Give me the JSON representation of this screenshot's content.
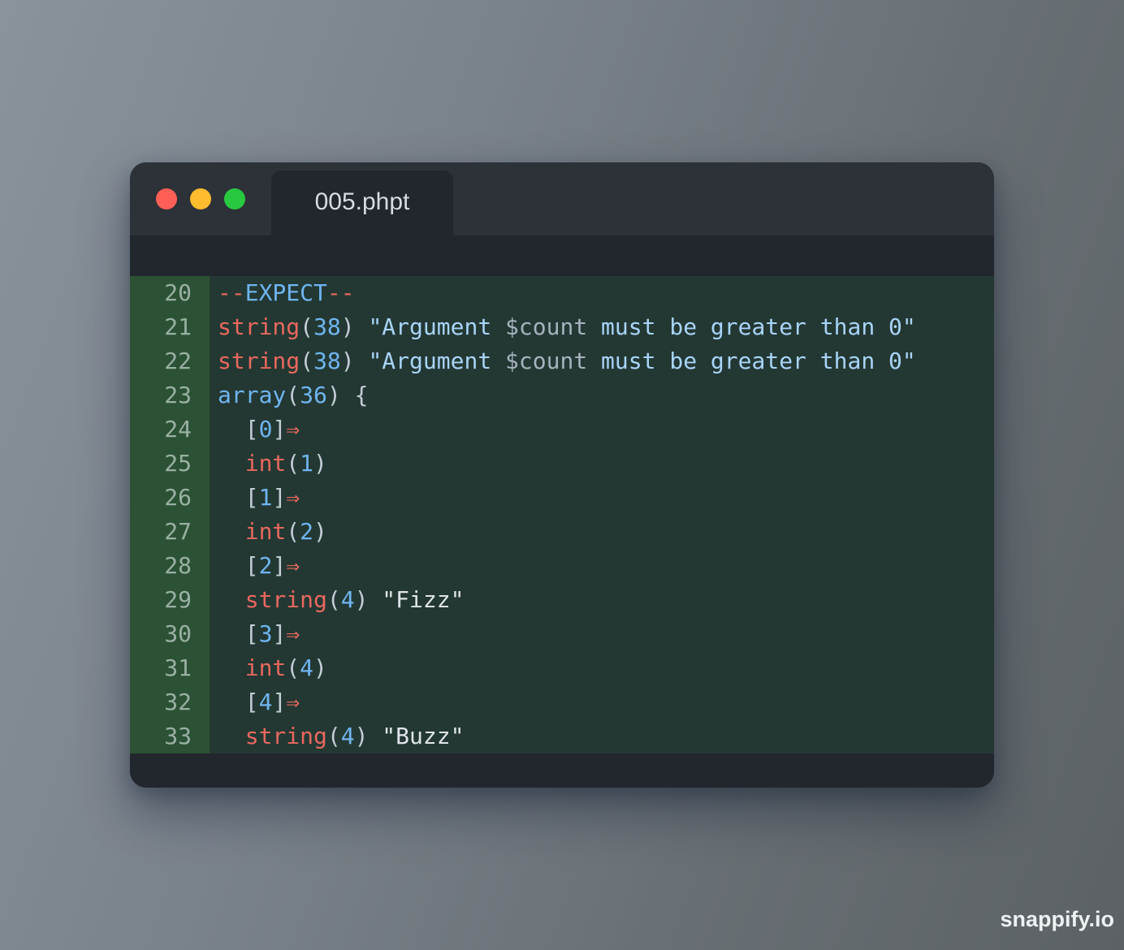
{
  "window": {
    "tab_label": "005.phpt"
  },
  "editor": {
    "lines": [
      {
        "number": "20",
        "tokens": [
          [
            "k",
            "--"
          ],
          [
            "b",
            "EXPECT"
          ],
          [
            "k",
            "--"
          ]
        ]
      },
      {
        "number": "21",
        "tokens": [
          [
            "k",
            "string"
          ],
          [
            "p",
            "("
          ],
          [
            "b",
            "38"
          ],
          [
            "p",
            ") "
          ],
          [
            "s",
            "\"Argument "
          ],
          [
            "v",
            "$count"
          ],
          [
            "s",
            " must be greater than 0\""
          ]
        ]
      },
      {
        "number": "22",
        "tokens": [
          [
            "k",
            "string"
          ],
          [
            "p",
            "("
          ],
          [
            "b",
            "38"
          ],
          [
            "p",
            ") "
          ],
          [
            "s",
            "\"Argument "
          ],
          [
            "v",
            "$count"
          ],
          [
            "s",
            " must be greater than 0\""
          ]
        ]
      },
      {
        "number": "23",
        "tokens": [
          [
            "b",
            "array"
          ],
          [
            "p",
            "("
          ],
          [
            "b",
            "36"
          ],
          [
            "p",
            ") {"
          ]
        ]
      },
      {
        "number": "24",
        "tokens": [
          [
            "p",
            "  ["
          ],
          [
            "b",
            "0"
          ],
          [
            "p",
            "]"
          ],
          [
            "k",
            "⇒"
          ]
        ]
      },
      {
        "number": "25",
        "tokens": [
          [
            "k",
            "  int"
          ],
          [
            "p",
            "("
          ],
          [
            "b",
            "1"
          ],
          [
            "p",
            ")"
          ]
        ]
      },
      {
        "number": "26",
        "tokens": [
          [
            "p",
            "  ["
          ],
          [
            "b",
            "1"
          ],
          [
            "p",
            "]"
          ],
          [
            "k",
            "⇒"
          ]
        ]
      },
      {
        "number": "27",
        "tokens": [
          [
            "k",
            "  int"
          ],
          [
            "p",
            "("
          ],
          [
            "b",
            "2"
          ],
          [
            "p",
            ")"
          ]
        ]
      },
      {
        "number": "28",
        "tokens": [
          [
            "p",
            "  ["
          ],
          [
            "b",
            "2"
          ],
          [
            "p",
            "]"
          ],
          [
            "k",
            "⇒"
          ]
        ]
      },
      {
        "number": "29",
        "tokens": [
          [
            "k",
            "  string"
          ],
          [
            "p",
            "("
          ],
          [
            "b",
            "4"
          ],
          [
            "p",
            ") "
          ],
          [
            "w",
            "\"Fizz\""
          ]
        ]
      },
      {
        "number": "30",
        "tokens": [
          [
            "p",
            "  ["
          ],
          [
            "b",
            "3"
          ],
          [
            "p",
            "]"
          ],
          [
            "k",
            "⇒"
          ]
        ]
      },
      {
        "number": "31",
        "tokens": [
          [
            "k",
            "  int"
          ],
          [
            "p",
            "("
          ],
          [
            "b",
            "4"
          ],
          [
            "p",
            ")"
          ]
        ]
      },
      {
        "number": "32",
        "tokens": [
          [
            "p",
            "  ["
          ],
          [
            "b",
            "4"
          ],
          [
            "p",
            "]"
          ],
          [
            "k",
            "⇒"
          ]
        ]
      },
      {
        "number": "33",
        "tokens": [
          [
            "k",
            "  string"
          ],
          [
            "p",
            "("
          ],
          [
            "b",
            "4"
          ],
          [
            "p",
            ") "
          ],
          [
            "w",
            "\"Buzz\""
          ]
        ]
      }
    ]
  },
  "watermark": "snappify.io",
  "colors": {
    "keyword": "#e8685e",
    "number": "#6fb5f0",
    "string": "#a8d4f8",
    "punctuation": "#c4ccd6",
    "code_background": "#233833",
    "gutter_background": "#2b5234",
    "close_button": "#ff5f57",
    "minimize_button": "#febc2e",
    "maximize_button": "#28c840"
  }
}
